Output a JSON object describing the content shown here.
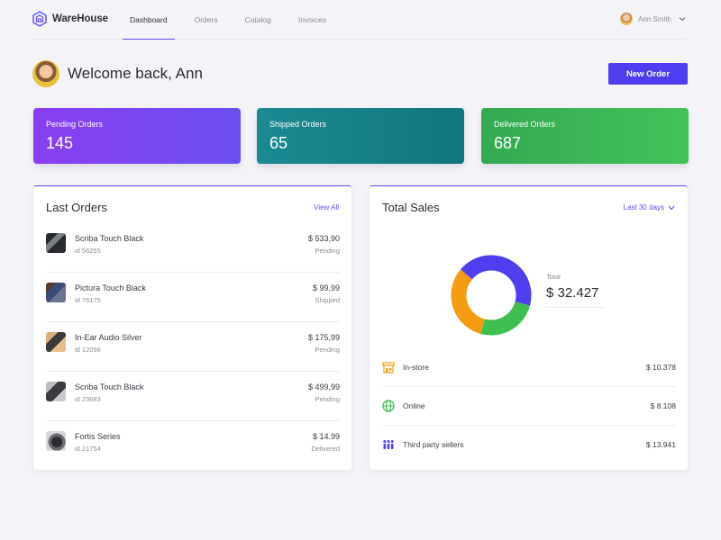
{
  "app": {
    "name": "WareHouse"
  },
  "nav": {
    "items": [
      {
        "label": "Dashboard",
        "active": true
      },
      {
        "label": "Orders"
      },
      {
        "label": "Catalog"
      },
      {
        "label": "Invoices"
      }
    ]
  },
  "user": {
    "name": "Ann Smith"
  },
  "welcome": {
    "text": "Welcome back, Ann"
  },
  "actions": {
    "new_order": "New Order"
  },
  "stats": [
    {
      "label": "Pending Orders",
      "value": "145"
    },
    {
      "label": "Shipped Orders",
      "value": "65"
    },
    {
      "label": "Delivered Orders",
      "value": "687"
    }
  ],
  "last_orders": {
    "title": "Last Orders",
    "link": "View All",
    "items": [
      {
        "name": "Scriba Touch Black",
        "id": "id 56255",
        "price": "$ 533,90",
        "status": "Pending"
      },
      {
        "name": "Pictura Touch Black",
        "id": "id 76175",
        "price": "$ 99,99",
        "status": "Shipped"
      },
      {
        "name": "In-Ear Audio Silver",
        "id": "id 12096",
        "price": "$ 175,99",
        "status": "Pending"
      },
      {
        "name": "Scriba Touch Black",
        "id": "id 23683",
        "price": "$ 499,99",
        "status": "Pending"
      },
      {
        "name": "Fortis Series",
        "id": "id 21754",
        "price": "$ 14.99",
        "status": "Delivered"
      }
    ]
  },
  "total_sales": {
    "title": "Total Sales",
    "range": "Last 30 days",
    "total_label": "Total",
    "total_value": "$ 32.427",
    "channels": [
      {
        "label": "In-store",
        "value": "$ 10.378",
        "icon": "store-icon",
        "color": "#f39c12",
        "amount": 10378
      },
      {
        "label": "Online",
        "value": "$ 8.108",
        "icon": "globe-icon",
        "color": "#3fbf4f",
        "amount": 8108
      },
      {
        "label": "Third party sellers",
        "value": "$ 13.941",
        "icon": "people-icon",
        "color": "#4e3ef0",
        "amount": 13941
      }
    ]
  },
  "colors": {
    "accent": "#4e3ef0"
  }
}
